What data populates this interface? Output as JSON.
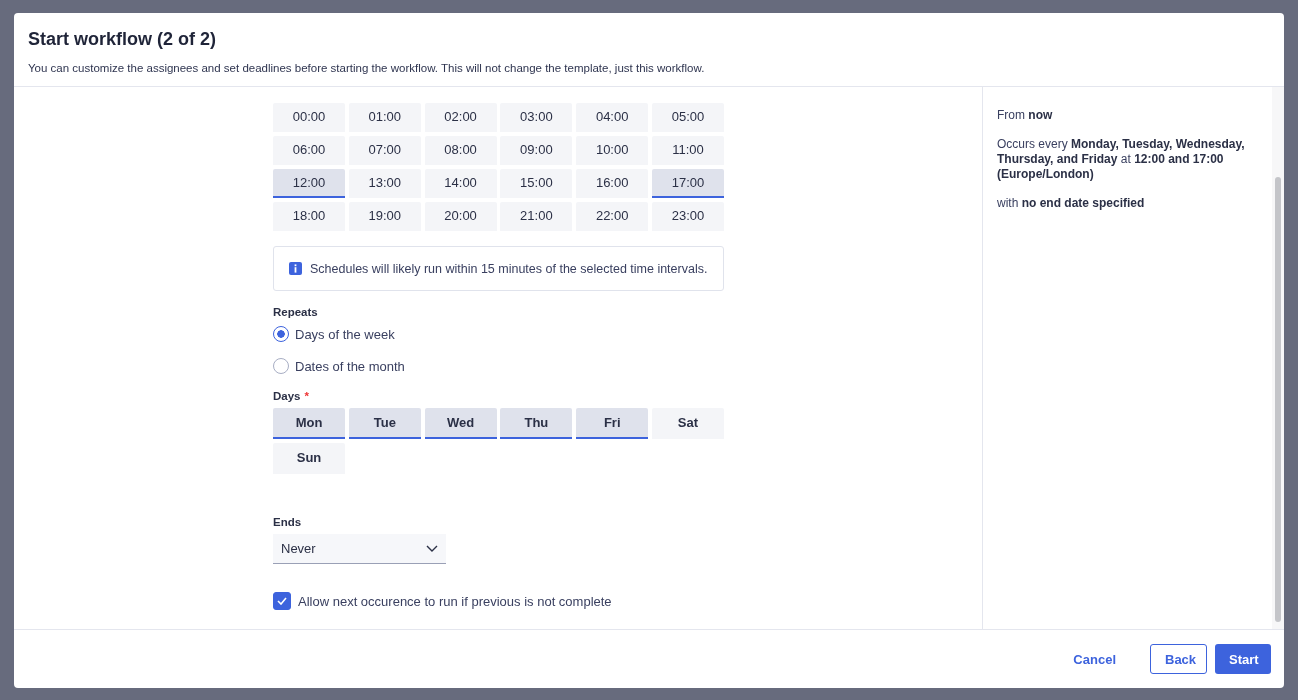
{
  "dialog": {
    "title": "Start workflow (2 of 2)",
    "subtitle": "You can customize the assignees and set deadlines before starting the workflow. This will not change the template, just this workflow."
  },
  "hours": [
    {
      "label": "00:00",
      "selected": false
    },
    {
      "label": "01:00",
      "selected": false
    },
    {
      "label": "02:00",
      "selected": false
    },
    {
      "label": "03:00",
      "selected": false
    },
    {
      "label": "04:00",
      "selected": false
    },
    {
      "label": "05:00",
      "selected": false
    },
    {
      "label": "06:00",
      "selected": false
    },
    {
      "label": "07:00",
      "selected": false
    },
    {
      "label": "08:00",
      "selected": false
    },
    {
      "label": "09:00",
      "selected": false
    },
    {
      "label": "10:00",
      "selected": false
    },
    {
      "label": "11:00",
      "selected": false
    },
    {
      "label": "12:00",
      "selected": true
    },
    {
      "label": "13:00",
      "selected": false
    },
    {
      "label": "14:00",
      "selected": false
    },
    {
      "label": "15:00",
      "selected": false
    },
    {
      "label": "16:00",
      "selected": false
    },
    {
      "label": "17:00",
      "selected": true
    },
    {
      "label": "18:00",
      "selected": false
    },
    {
      "label": "19:00",
      "selected": false
    },
    {
      "label": "20:00",
      "selected": false
    },
    {
      "label": "21:00",
      "selected": false
    },
    {
      "label": "22:00",
      "selected": false
    },
    {
      "label": "23:00",
      "selected": false
    }
  ],
  "info_note": "Schedules will likely run within 15 minutes of the selected time intervals.",
  "repeats": {
    "label": "Repeats",
    "options": [
      {
        "label": "Days of the week",
        "selected": true
      },
      {
        "label": "Dates of the month",
        "selected": false
      }
    ]
  },
  "days": {
    "label": "Days",
    "required_mark": "*",
    "items": [
      {
        "label": "Mon",
        "selected": true
      },
      {
        "label": "Tue",
        "selected": true
      },
      {
        "label": "Wed",
        "selected": true
      },
      {
        "label": "Thu",
        "selected": true
      },
      {
        "label": "Fri",
        "selected": true
      },
      {
        "label": "Sat",
        "selected": false
      },
      {
        "label": "Sun",
        "selected": false
      }
    ]
  },
  "ends": {
    "label": "Ends",
    "value": "Never"
  },
  "allow_overlap": {
    "label": "Allow next occurence to run if previous is not complete",
    "checked": true
  },
  "summary": [
    "From **now**",
    "Occurs every **Monday, Tuesday, Wednesday, Thursday, and Friday** at **12:00 and 17:00 (Europe/London)**",
    "with **no end date specified**"
  ],
  "buttons": [
    {
      "label": "Cancel",
      "kind": "link"
    },
    {
      "label": "Back",
      "kind": "secondary"
    },
    {
      "label": "Start",
      "kind": "primary"
    }
  ]
}
